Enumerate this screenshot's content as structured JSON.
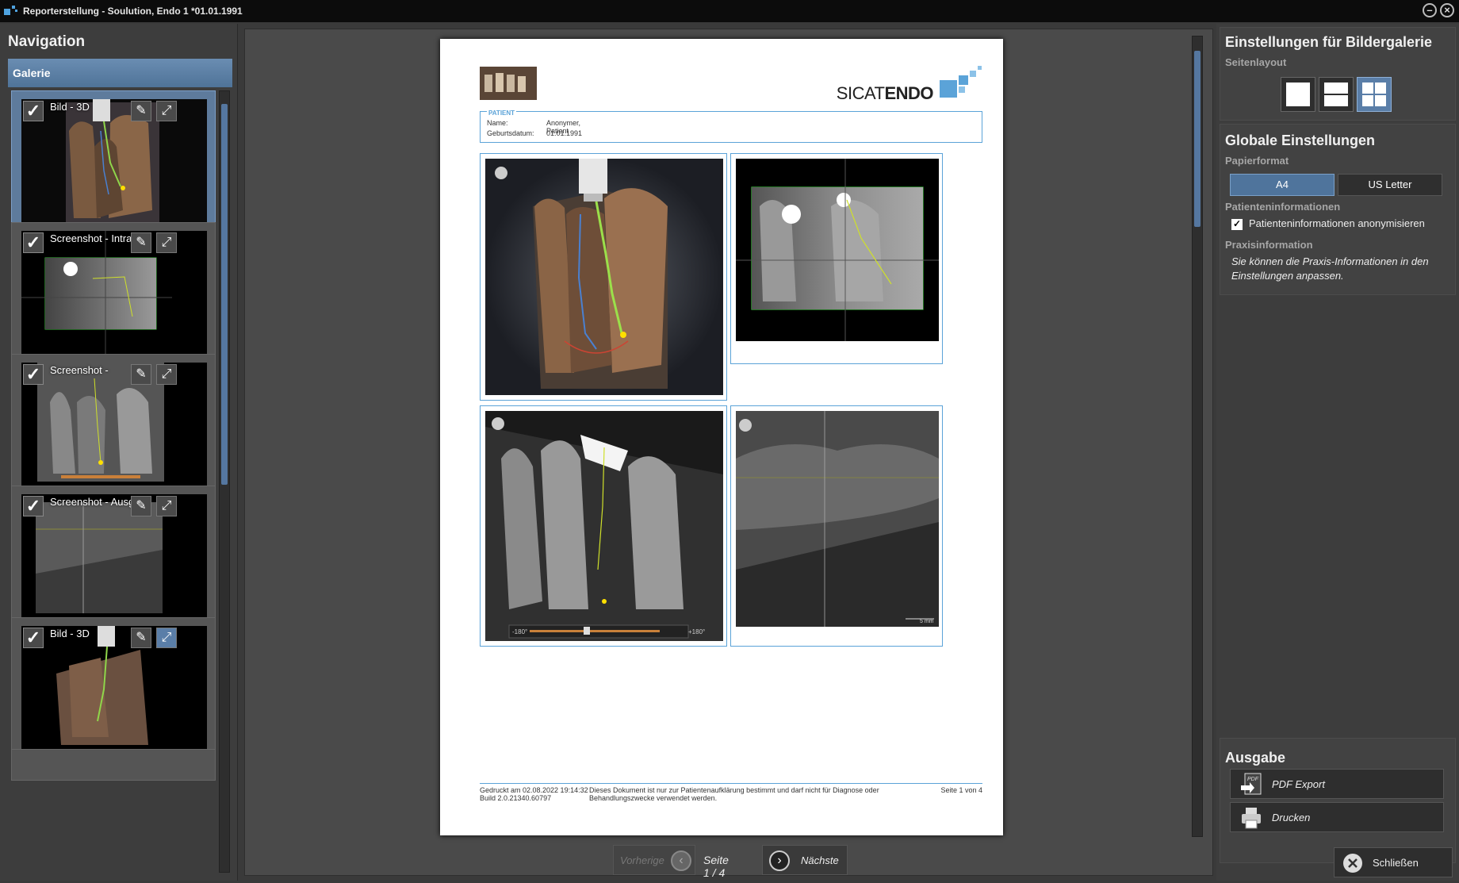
{
  "window": {
    "title": "Reporterstellung - Soulution, Endo 1 *01.01.1991"
  },
  "navigation": {
    "title": "Navigation",
    "gallery_header": "Galerie",
    "items": [
      {
        "label": "Bild - 3D",
        "selected": true
      },
      {
        "label": "Screenshot - Intra…",
        "selected": false
      },
      {
        "label": "Screenshot -",
        "selected": false
      },
      {
        "label": "Screenshot - Ausg…",
        "selected": false
      },
      {
        "label": "Bild - 3D",
        "selected": false
      }
    ],
    "icons": {
      "check": "check-icon",
      "edit": "edit-icon",
      "expand": "expand-icon"
    }
  },
  "report": {
    "brand_light": "SICAT",
    "brand_bold": "ENDO",
    "patient_header": "PATIENT",
    "name_label": "Name:",
    "name_value": "Anonymer, Patient",
    "dob_label": "Geburtsdatum:",
    "dob_value": "01.01.1991",
    "slider_min": "-180°",
    "slider_max": "+180°",
    "scale_label": "5 mm",
    "footer_printed": "Gedruckt am 02.08.2022 19:14:32",
    "footer_build": "Build 2.0.21340.60797",
    "footer_note": "Dieses Dokument ist nur zur Patientenaufklärung bestimmt und darf nicht für Diagnose oder Behandlungszwecke verwendet werden.",
    "footer_page": "Seite 1 von 4"
  },
  "pager": {
    "prev_label": "Vorherige",
    "page_label": "Seite 1 / 4",
    "next_label": "Nächste"
  },
  "settings": {
    "gallery_title": "Einstellungen für Bildergalerie",
    "layout_label": "Seitenlayout",
    "layout_selected": "2x2",
    "global_title": "Globale Einstellungen",
    "paper_label": "Papierformat",
    "paper_a4": "A4",
    "paper_letter": "US Letter",
    "paper_selected": "A4",
    "patient_info_label": "Patienteninformationen",
    "anonymize_label": "Patienteninformationen anonymisieren",
    "anonymize_checked": true,
    "practice_label": "Praxisinformation",
    "practice_text": "Sie können die Praxis-Informationen in den Einstellungen anpassen.",
    "output_title": "Ausgabe",
    "pdf_export": "PDF Export",
    "print": "Drucken",
    "close": "Schließen"
  },
  "colors": {
    "accent": "#5ba3d8",
    "selection": "#5a7ea8",
    "background": "#3d3d3d"
  }
}
